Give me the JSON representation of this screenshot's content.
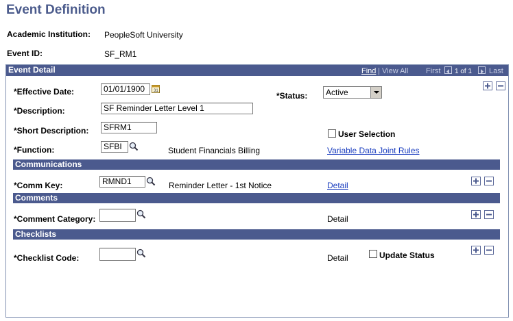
{
  "page": {
    "title": "Event Definition"
  },
  "header": {
    "institution_label": "Academic Institution:",
    "institution_value": "PeopleSoft University",
    "event_id_label": "Event ID:",
    "event_id_value": "SF_RM1"
  },
  "event_detail": {
    "bar_title": "Event Detail",
    "find": "Find",
    "separator": "|",
    "view_all": "View All",
    "first": "First",
    "count": "1 of 1",
    "last": "Last",
    "effective_date_label": "*Effective Date:",
    "effective_date_value": "01/01/1900",
    "status_label": "*Status:",
    "status_value": "Active",
    "description_label": "*Description:",
    "description_value": "SF Reminder Letter Level 1",
    "short_description_label": "*Short Description:",
    "short_description_value": "SFRM1",
    "user_selection_label": "User Selection",
    "function_label": "*Function:",
    "function_value": "SFBI",
    "function_desc": "Student Financials Billing",
    "variable_data_link": "Variable Data Joint Rules"
  },
  "communications": {
    "bar_title": "Communications",
    "comm_key_label": "*Comm Key:",
    "comm_key_value": "RMND1",
    "comm_key_desc": "Reminder Letter - 1st Notice",
    "detail_link": "Detail"
  },
  "comments": {
    "bar_title": "Comments",
    "category_label": "*Comment Category:",
    "category_value": "",
    "detail_text": "Detail"
  },
  "checklists": {
    "bar_title": "Checklists",
    "code_label": "*Checklist Code:",
    "code_value": "",
    "detail_text": "Detail",
    "update_status_label": "Update Status"
  }
}
